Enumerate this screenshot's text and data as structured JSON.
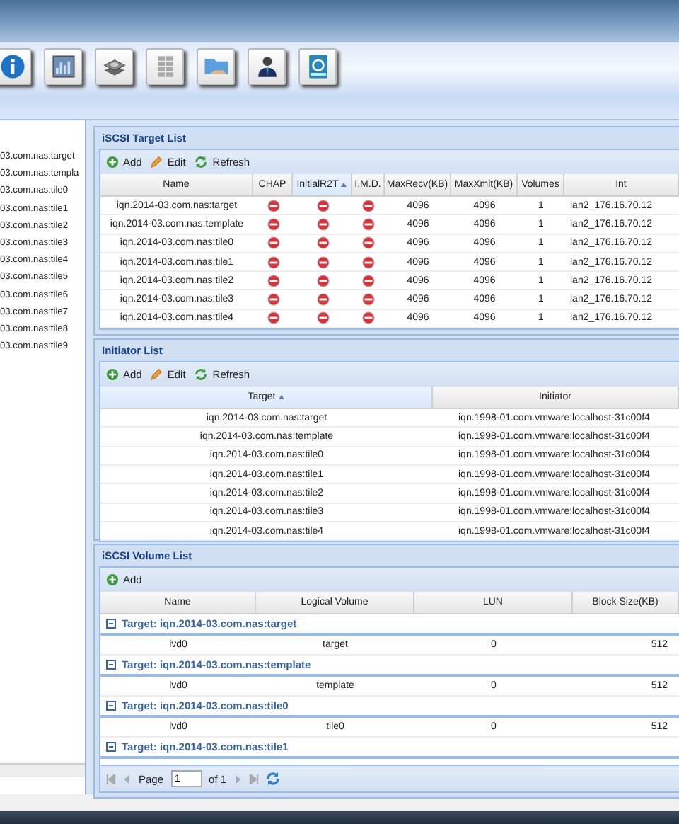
{
  "toolbar": {
    "buttons": [
      {
        "kind": "info"
      },
      {
        "kind": "chart"
      },
      {
        "kind": "disks"
      },
      {
        "kind": "rack"
      },
      {
        "kind": "share"
      },
      {
        "kind": "user"
      },
      {
        "kind": "backup"
      }
    ]
  },
  "sidebar": {
    "items": [
      "03.com.nas:target",
      "03.com.nas:templa",
      "03.com.nas:tile0",
      "03.com.nas:tile1",
      "03.com.nas:tile2",
      "03.com.nas:tile3",
      "03.com.nas:tile4",
      "03.com.nas:tile5",
      "03.com.nas:tile6",
      "03.com.nas:tile7",
      "03.com.nas:tile8",
      "03.com.nas:tile9"
    ]
  },
  "target_list": {
    "title": "iSCSI Target List",
    "actions": [
      {
        "kind": "add",
        "label": "Add"
      },
      {
        "kind": "edit",
        "label": "Edit"
      },
      {
        "kind": "refresh",
        "label": "Refresh"
      }
    ],
    "columns": [
      {
        "label": "Name",
        "sorted": false
      },
      {
        "label": "CHAP",
        "sorted": false
      },
      {
        "label": "InitialR2T",
        "sorted": true
      },
      {
        "label": "I.M.D.",
        "sorted": false
      },
      {
        "label": "MaxRecv(KB)",
        "sorted": false
      },
      {
        "label": "MaxXmit(KB)",
        "sorted": false
      },
      {
        "label": "Volumes",
        "sorted": false
      },
      {
        "label": "Int",
        "sorted": false
      }
    ],
    "rows": [
      {
        "name": "iqn.2014-03.com.nas:target",
        "chap": false,
        "initial_r2t": false,
        "imd": false,
        "max_recv": "4096",
        "max_xmit": "4096",
        "volumes": "1",
        "interface": "lan2_176.16.70.12"
      },
      {
        "name": "iqn.2014-03.com.nas:template",
        "chap": false,
        "initial_r2t": false,
        "imd": false,
        "max_recv": "4096",
        "max_xmit": "4096",
        "volumes": "1",
        "interface": "lan2_176.16.70.12"
      },
      {
        "name": "iqn.2014-03.com.nas:tile0",
        "chap": false,
        "initial_r2t": false,
        "imd": false,
        "max_recv": "4096",
        "max_xmit": "4096",
        "volumes": "1",
        "interface": "lan2_176.16.70.12"
      },
      {
        "name": "iqn.2014-03.com.nas:tile1",
        "chap": false,
        "initial_r2t": false,
        "imd": false,
        "max_recv": "4096",
        "max_xmit": "4096",
        "volumes": "1",
        "interface": "lan2_176.16.70.12"
      },
      {
        "name": "iqn.2014-03.com.nas:tile2",
        "chap": false,
        "initial_r2t": false,
        "imd": false,
        "max_recv": "4096",
        "max_xmit": "4096",
        "volumes": "1",
        "interface": "lan2_176.16.70.12"
      },
      {
        "name": "iqn.2014-03.com.nas:tile3",
        "chap": false,
        "initial_r2t": false,
        "imd": false,
        "max_recv": "4096",
        "max_xmit": "4096",
        "volumes": "1",
        "interface": "lan2_176.16.70.12"
      },
      {
        "name": "iqn.2014-03.com.nas:tile4",
        "chap": false,
        "initial_r2t": false,
        "imd": false,
        "max_recv": "4096",
        "max_xmit": "4096",
        "volumes": "1",
        "interface": "lan2_176.16.70.12"
      }
    ]
  },
  "initiator_list": {
    "title": "Initiator List",
    "actions": [
      {
        "kind": "add",
        "label": "Add"
      },
      {
        "kind": "edit",
        "label": "Edit"
      },
      {
        "kind": "refresh",
        "label": "Refresh"
      }
    ],
    "columns": [
      {
        "label": "Target",
        "sorted": true
      },
      {
        "label": "Initiator",
        "sorted": false
      }
    ],
    "rows": [
      {
        "target": "iqn.2014-03.com.nas:target",
        "initiator": "iqn.1998-01.com.vmware:localhost-31c00f4"
      },
      {
        "target": "iqn.2014-03.com.nas:template",
        "initiator": "iqn.1998-01.com.vmware:localhost-31c00f4"
      },
      {
        "target": "iqn.2014-03.com.nas:tile0",
        "initiator": "iqn.1998-01.com.vmware:localhost-31c00f4"
      },
      {
        "target": "iqn.2014-03.com.nas:tile1",
        "initiator": "iqn.1998-01.com.vmware:localhost-31c00f4"
      },
      {
        "target": "iqn.2014-03.com.nas:tile2",
        "initiator": "iqn.1998-01.com.vmware:localhost-31c00f4"
      },
      {
        "target": "iqn.2014-03.com.nas:tile3",
        "initiator": "iqn.1998-01.com.vmware:localhost-31c00f4"
      },
      {
        "target": "iqn.2014-03.com.nas:tile4",
        "initiator": "iqn.1998-01.com.vmware:localhost-31c00f4"
      }
    ]
  },
  "volume_list": {
    "title": "iSCSI Volume List",
    "actions": [
      {
        "kind": "add",
        "label": "Add"
      }
    ],
    "columns": [
      "Name",
      "Logical Volume",
      "LUN",
      "Block Size(KB)"
    ],
    "groups": [
      {
        "label": "Target: iqn.2014-03.com.nas:target",
        "expanded": true,
        "rows": [
          {
            "name": "ivd0",
            "logical_volume": "target",
            "lun": "0",
            "block_size": "512"
          }
        ]
      },
      {
        "label": "Target: iqn.2014-03.com.nas:template",
        "expanded": true,
        "rows": [
          {
            "name": "ivd0",
            "logical_volume": "template",
            "lun": "0",
            "block_size": "512"
          }
        ]
      },
      {
        "label": "Target: iqn.2014-03.com.nas:tile0",
        "expanded": true,
        "rows": [
          {
            "name": "ivd0",
            "logical_volume": "tile0",
            "lun": "0",
            "block_size": "512"
          }
        ]
      },
      {
        "label": "Target: iqn.2014-03.com.nas:tile1",
        "expanded": true
      }
    ],
    "pager": {
      "page_label": "Page",
      "page": "1",
      "of_label": "of 1"
    }
  }
}
